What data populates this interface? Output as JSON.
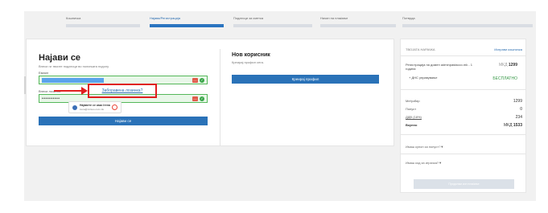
{
  "steps": [
    {
      "label": "Кошничка",
      "active": false
    },
    {
      "label": "Најава/Регистрација",
      "active": true
    },
    {
      "label": "Податоци за сметка",
      "active": false
    },
    {
      "label": "Начин на плаќање",
      "active": false
    },
    {
      "label": "Потврда",
      "active": false
    }
  ],
  "login": {
    "title": "Најави се",
    "subtitle": "Внеси ги твоите податоци во полињата подолу",
    "email_label": "Емаил",
    "email_value": "",
    "password_label": "Внеси лозинка",
    "password_value": "••••••••••",
    "button_label": "Најави се",
    "forgot_label": "Заборавена лозинка?"
  },
  "badge": {
    "line1": "Најавете се како Irena",
    "line2": "irena@mrisoo.com.mk"
  },
  "register": {
    "title": "Нов корисник",
    "subtitle": "Креирај профил сега.",
    "button_label": "Креирај профил"
  },
  "cart": {
    "header": "ТВОЈАТА НАРАЧКА",
    "edit_label": "Исправи кошничка",
    "item_name": "Регистрација на домен adminpastacco.mk - 1 година",
    "item_price_currency": "МКД",
    "item_price_value": "1299",
    "addon_name": "+ ДНС управување",
    "addon_price": "БЕСПЛАТНО",
    "subtotal_label": "Меѓузбир",
    "subtotal_value": "1299",
    "discount_label": "Попуст",
    "discount_value": "0",
    "vat_label": "ДДВ (18%)",
    "vat_value": "234",
    "total_label": "Вкупно",
    "total_currency": "МКД",
    "total_value": "1533",
    "coupon_question": "Имаш купон за попуст?▼",
    "ref_question": "Имаш код за играчка?▼",
    "checkout_label": "Продолжи кон плаќање"
  }
}
